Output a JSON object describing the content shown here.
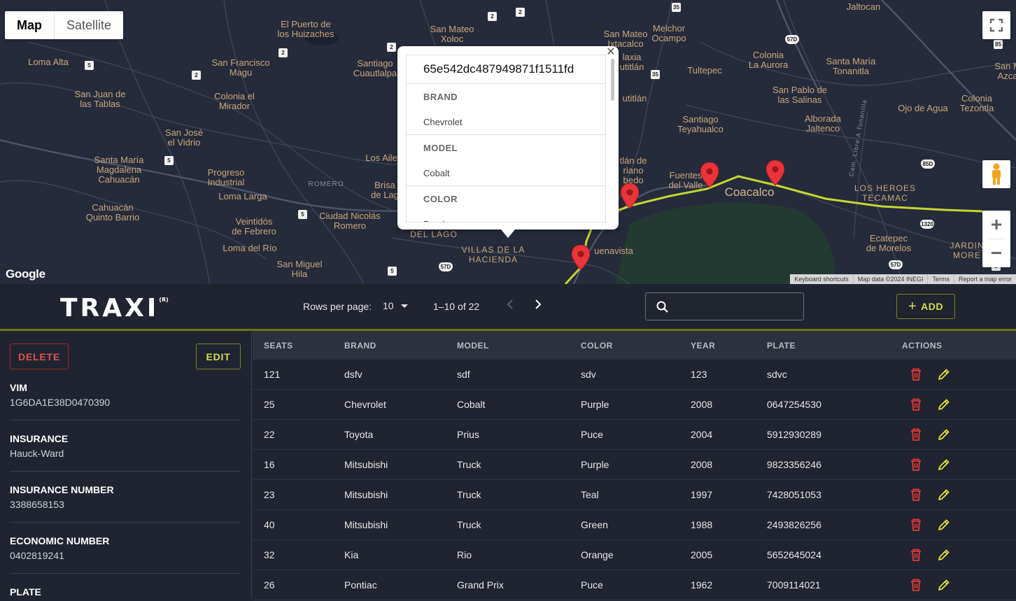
{
  "map": {
    "type_controls": [
      "Map",
      "Satellite"
    ],
    "active_type": "Map",
    "google_label": "Google",
    "attribution": [
      "Keyboard shortcuts",
      "Map data ©2024 INEGI",
      "Terms",
      "Report a map error"
    ],
    "zoom_in": "+",
    "zoom_out": "−",
    "labels": {
      "l1": "El Puerto de\nlos Huizaches",
      "l2": "San Mateo\nXoloc",
      "l3": "San Mateo\nIxtacalco",
      "l4": "Melchor\nOcampo",
      "l5": "Jaltocan",
      "l6": "Loma Alta",
      "l7": "San Francisco\nMagu",
      "l8": "Santiago\nCuautlalpa",
      "l9": "Tultepec",
      "l10": "Colonia\nLa Aurora",
      "l11": "Santa María\nTonanitla",
      "l12": "San M\nAzca",
      "l13": "San Juan de\nlas Tablas",
      "l14": "Colonia el\nMirador",
      "l15": "San Pablo de\nlas Salinas",
      "l16": "Colonia\nTezontla",
      "l17": "Ojo de Agua",
      "l18": "Alborada\nJaltenco",
      "l19": "San José\nel Vidrio",
      "l20": "Santiago\nTeyahualco",
      "l21": "Santa María\nMagdalena\nCahuacán",
      "l22": "Progreso\nIndustrial",
      "l23": "Los Aile",
      "l24": "Brisa\nde Lag",
      "l25": "Loma Larga",
      "l26": "Fuentes\ndel Valle",
      "l27": "Coacalco",
      "l28": "LOS HEROES\nTECAMAC",
      "l29": "Cahuacán\nQuinto Barrio",
      "l30": "Veintidós\nde Febrero",
      "l31": "Ciudad Nicolás\nRomero",
      "l32": "DEL LAGO",
      "l33": "VILLAS DE LA\nHACIENDA",
      "l34": "uenavista",
      "l35": "Ecatepec\nde Morelos",
      "l36": "JARDIN\nMORE",
      "l37": "Loma del Río",
      "l38": "San Miguel\nHila",
      "l39": "ROMERO",
      "l40": "tlán de\nriano\nbedo",
      "l41": "laxia\nutitlán",
      "l42": "utitlán",
      "l43": "Cam. Libre A Tonanitla"
    },
    "shields": [
      "2",
      "2",
      "35",
      "2",
      "2",
      "57D",
      "85",
      "5",
      "2",
      "35",
      "5",
      "5",
      "85D",
      "5",
      "57D",
      "5",
      "1320",
      "57D",
      "85"
    ]
  },
  "infowindow": {
    "title": "65e542dc487949871f1511fd",
    "sections": [
      {
        "key": "BRAND",
        "value": "Chevrolet"
      },
      {
        "key": "MODEL",
        "value": "Cobalt"
      },
      {
        "key": "COLOR",
        "value": "Purple"
      }
    ]
  },
  "toolbar": {
    "logo": "TRAXI",
    "logo_mark": "(R)",
    "rows_per_page_label": "Rows per page:",
    "rows_per_page_value": "10",
    "range": "1–10 of 22",
    "search_placeholder": "",
    "add_label": "ADD"
  },
  "detail": {
    "delete_label": "DELETE",
    "edit_label": "EDIT",
    "fields": [
      {
        "key": "VIM",
        "value": "1G6DA1E38D0470390"
      },
      {
        "key": "INSURANCE",
        "value": "Hauck-Ward"
      },
      {
        "key": "INSURANCE NUMBER",
        "value": "3388658153"
      },
      {
        "key": "ECONOMIC NUMBER",
        "value": "0402819241"
      },
      {
        "key": "PLATE",
        "value": ""
      }
    ]
  },
  "table": {
    "headers": [
      "SEATS",
      "BRAND",
      "MODEL",
      "COLOR",
      "YEAR",
      "PLATE",
      "ACTIONS"
    ],
    "rows": [
      [
        "121",
        "dsfv",
        "sdf",
        "sdv",
        "123",
        "sdvc"
      ],
      [
        "25",
        "Chevrolet",
        "Cobalt",
        "Purple",
        "2008",
        "0647254530"
      ],
      [
        "22",
        "Toyota",
        "Prius",
        "Puce",
        "2004",
        "5912930289"
      ],
      [
        "16",
        "Mitsubishi",
        "Truck",
        "Purple",
        "2008",
        "9823356246"
      ],
      [
        "23",
        "Mitsubishi",
        "Truck",
        "Teal",
        "1997",
        "7428051053"
      ],
      [
        "40",
        "Mitsubishi",
        "Truck",
        "Green",
        "1988",
        "2493826256"
      ],
      [
        "32",
        "Kia",
        "Rio",
        "Orange",
        "2005",
        "5652645024"
      ],
      [
        "26",
        "Pontiac",
        "Grand Prix",
        "Puce",
        "1962",
        "7009114021"
      ]
    ]
  },
  "colors": {
    "accent": "#d8de4a",
    "danger": "#e05252",
    "route": "#c6d62f",
    "pin": "#e8343a"
  }
}
